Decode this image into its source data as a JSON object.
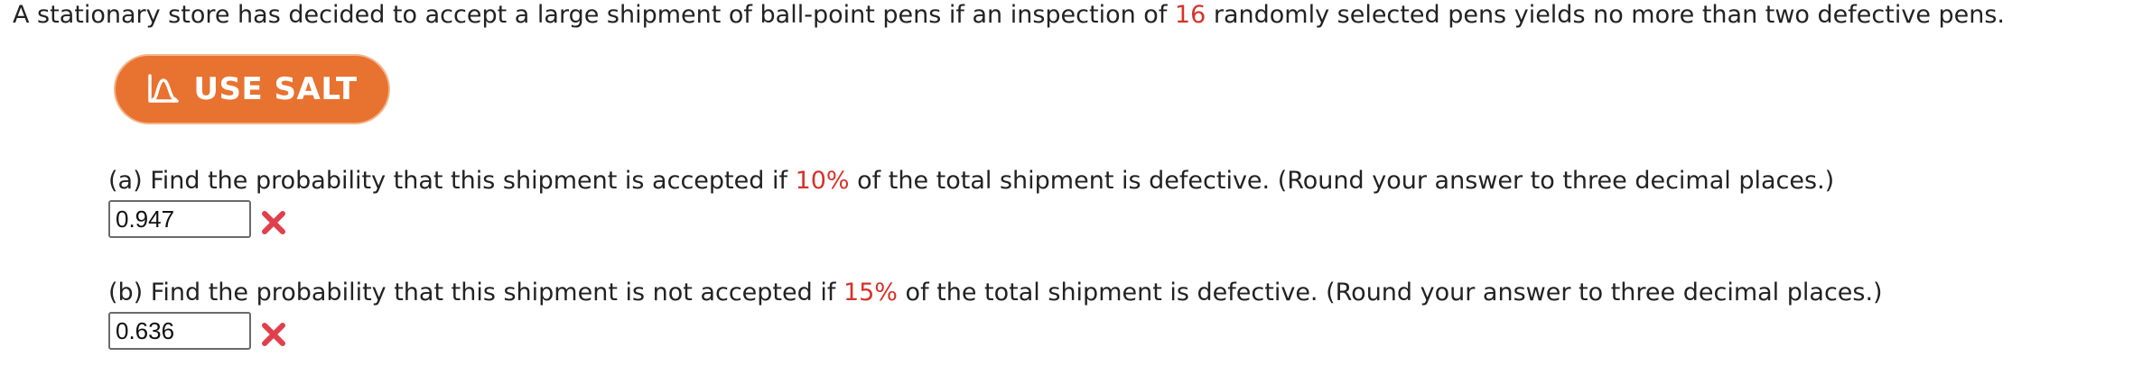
{
  "problem": {
    "stem_part1": "A stationary store has decided to accept a large shipment of ball-point pens if an inspection of ",
    "stem_highlight": "16",
    "stem_part2": " randomly selected pens yields no more than two defective pens."
  },
  "salt_button": {
    "label": "USE SALT",
    "icon": "salt-distribution-icon",
    "color": "#e8722f"
  },
  "part_a": {
    "text_before": "(a) Find the probability that this shipment is accepted if ",
    "highlight": "10%",
    "text_after": " of the total shipment is defective. (Round your answer to three decimal places.)",
    "answer_value": "0.947",
    "status_icon": "incorrect-x-icon"
  },
  "part_b": {
    "text_before": "(b) Find the probability that this shipment is not accepted if ",
    "highlight": "15%",
    "text_after": " of the total shipment is defective. (Round your answer to three decimal places.)",
    "answer_value": "0.636",
    "status_icon": "incorrect-x-icon"
  },
  "colors": {
    "highlight": "#d6322a",
    "incorrect": "#e0404b"
  }
}
